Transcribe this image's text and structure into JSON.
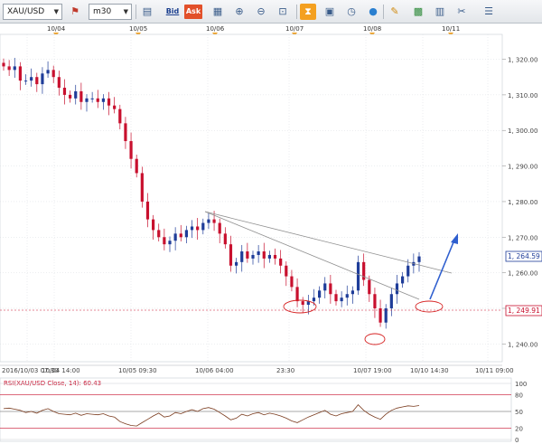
{
  "toolbar": {
    "symbol": "XAU/USD",
    "timeframe": "m30",
    "bid_label": "Bid",
    "ask_label": "Ask"
  },
  "date_markers": [
    "10/04",
    "10/05",
    "10/06",
    "10/07",
    "10/08",
    "10/11"
  ],
  "time_axis": [
    "2016/10/03 07:30",
    "10/04 14:00",
    "10/05 09:30",
    "10/06 04:00",
    "23:30",
    "10/07 19:00",
    "10/10 14:30",
    "10/11 09:00"
  ],
  "price_axis": [
    "1, 320.00",
    "1, 310.00",
    "1, 300.00",
    "1, 290.00",
    "1, 280.00",
    "1, 270.00",
    "1, 260.00",
    "1, 250.00",
    "1, 240.00"
  ],
  "price_tags": {
    "current": "1, 264.59",
    "level": "1, 249.91"
  },
  "indicator": {
    "label": "RSI(XAU/USD Close, 14): 60.43",
    "scale": [
      "100",
      "80",
      "50",
      "20",
      "0"
    ]
  },
  "colors": {
    "bull": "#1f3d99",
    "bear": "#c8102e",
    "rsi_line": "#7a3b1e",
    "arrow": "#2f5fcf",
    "annotation": "#d62020"
  },
  "chart_data": {
    "type": "candlestick",
    "ylim": [
      1235,
      1327
    ],
    "close": [
      1318,
      1317,
      1318,
      1314,
      1314,
      1315,
      1313,
      1316,
      1317,
      1315,
      1312,
      1310,
      1309,
      1311,
      1308,
      1309,
      1309,
      1308,
      1309,
      1307,
      1306,
      1302,
      1297,
      1292,
      1288,
      1280,
      1275,
      1272,
      1270,
      1268,
      1269,
      1271,
      1270,
      1272,
      1273,
      1272,
      1274,
      1275,
      1274,
      1271,
      1268,
      1262,
      1263,
      1266,
      1264,
      1265,
      1266,
      1264,
      1265,
      1264,
      1262,
      1259,
      1256,
      1252,
      1251,
      1252,
      1253,
      1255,
      1257,
      1254,
      1252,
      1253,
      1254,
      1255,
      1263,
      1258,
      1254,
      1250,
      1246,
      1250,
      1254,
      1257,
      1259,
      1262,
      1263,
      1264.59
    ],
    "rsi_ylim": [
      0,
      100
    ],
    "rsi": [
      55,
      56,
      54,
      52,
      48,
      50,
      47,
      52,
      55,
      50,
      46,
      45,
      44,
      47,
      43,
      46,
      45,
      44,
      46,
      42,
      40,
      32,
      28,
      25,
      24,
      30,
      36,
      42,
      47,
      40,
      42,
      48,
      46,
      50,
      53,
      50,
      55,
      57,
      54,
      48,
      42,
      35,
      38,
      45,
      42,
      46,
      48,
      44,
      47,
      45,
      42,
      38,
      33,
      30,
      35,
      40,
      44,
      48,
      52,
      45,
      42,
      46,
      48,
      50,
      62,
      52,
      45,
      40,
      36,
      45,
      52,
      56,
      58,
      60,
      59,
      60.43
    ]
  }
}
